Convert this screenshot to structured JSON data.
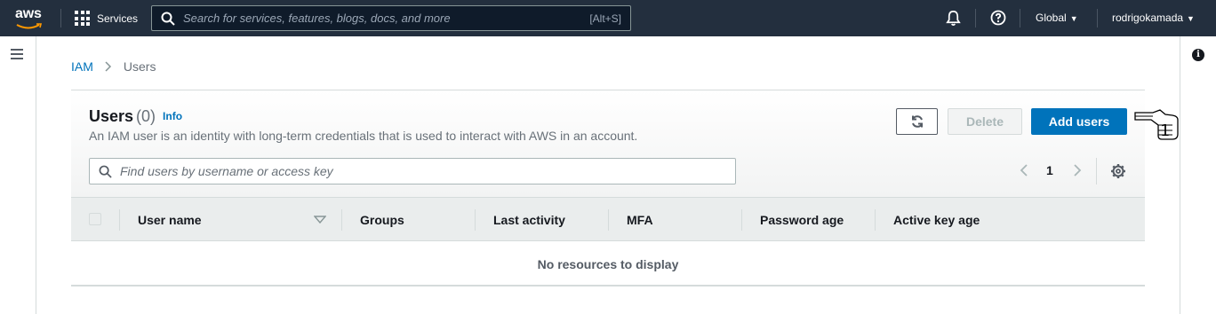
{
  "topnav": {
    "logo_text": "aws",
    "services_label": "Services",
    "search_placeholder": "Search for services, features, blogs, docs, and more",
    "search_shortcut": "[Alt+S]",
    "region_label": "Global",
    "account_label": "rodrigokamada"
  },
  "breadcrumb": {
    "root": "IAM",
    "current": "Users"
  },
  "users_panel": {
    "title": "Users",
    "count": "(0)",
    "info_link": "Info",
    "description": "An IAM user is an identity with long-term credentials that is used to interact with AWS in an account.",
    "delete_label": "Delete",
    "add_users_label": "Add users",
    "filter_placeholder": "Find users by username or access key",
    "page_number": "1",
    "columns": [
      "User name",
      "Groups",
      "Last activity",
      "MFA",
      "Password age",
      "Active key age"
    ],
    "empty_message": "No resources to display"
  },
  "annotation": {
    "step_number": "1"
  },
  "colors": {
    "nav_bg": "#232f3e",
    "primary": "#0073bb",
    "link": "#0073bb",
    "border": "#d5dbdb"
  }
}
